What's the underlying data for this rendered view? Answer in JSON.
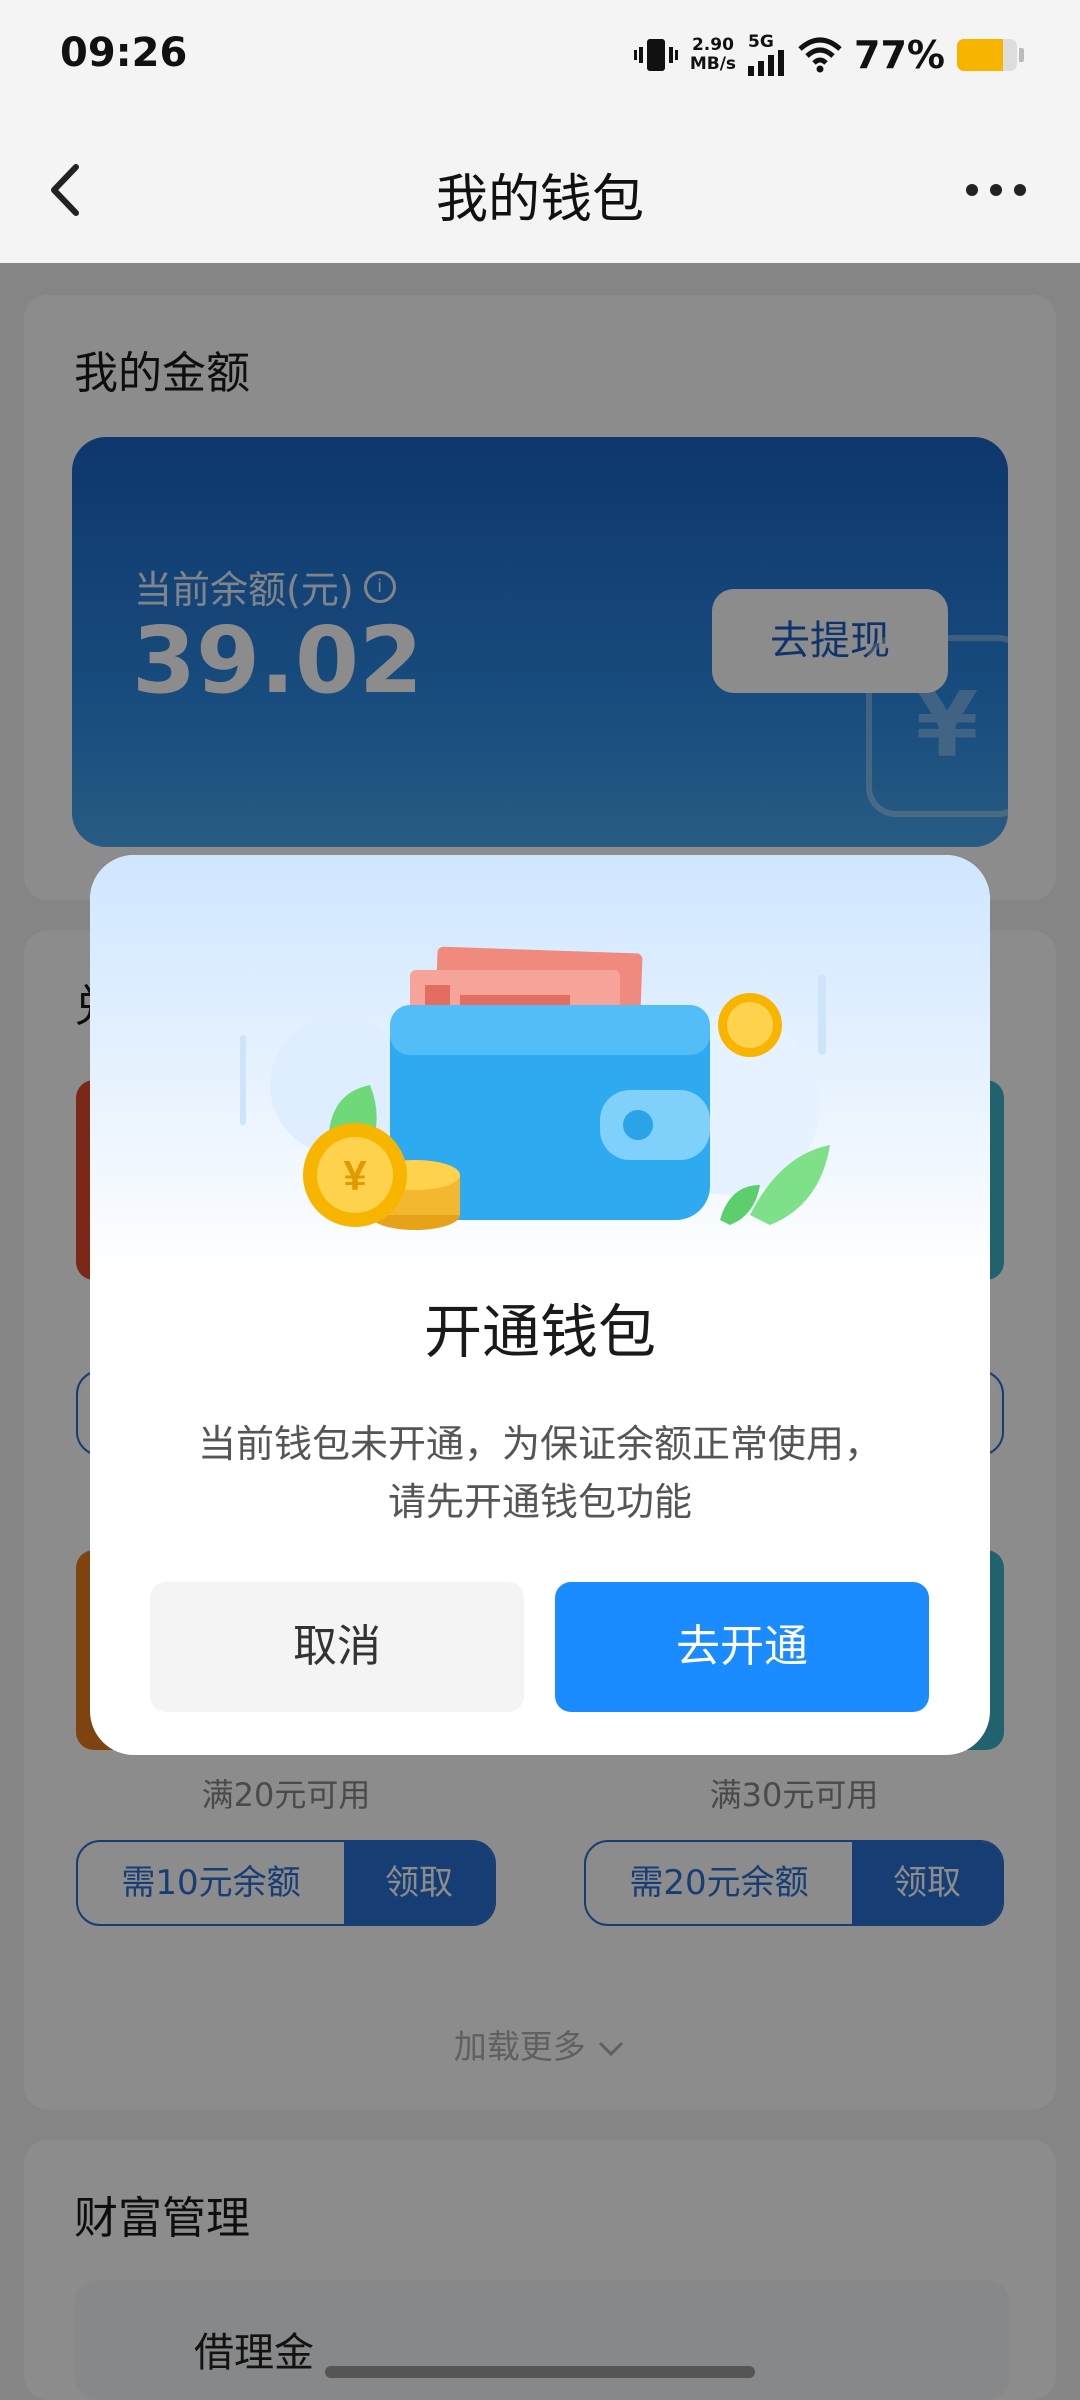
{
  "status_bar": {
    "time": "09:26",
    "net_speed_value": "2.90",
    "net_speed_unit": "MB/s",
    "network": "5G",
    "battery_percent_text": "77%",
    "battery_level": 0.77,
    "battery_color": "#f7b500"
  },
  "nav": {
    "title": "我的钱包",
    "back_icon": "chevron-left-icon",
    "more_icon": "more-dots-icon"
  },
  "balance_section": {
    "title": "我的金额",
    "label": "当前余额(元)",
    "value": "39.02",
    "withdraw_label": "去提现"
  },
  "coupon_section": {
    "title_partial": "兑",
    "row2": [
      {
        "condition": "满20元可用",
        "need": "需10元余额",
        "claim": "领取",
        "band_color": "#e87b1c"
      },
      {
        "condition": "满30元可用",
        "need": "需20元余额",
        "claim": "领取",
        "band_color": "#3bb3c7"
      }
    ],
    "row1_colors": [
      "#e2492f",
      "#3bb3c7"
    ]
  },
  "load_more": "加载更多",
  "wealth_section": {
    "title": "财富管理",
    "partial_item": "借理金"
  },
  "dialog": {
    "title": "开通钱包",
    "message": "当前钱包未开通，为保证余额正常使用，请先开通钱包功能",
    "cancel_label": "取消",
    "confirm_label": "去开通",
    "accent": "#1a8cff"
  }
}
